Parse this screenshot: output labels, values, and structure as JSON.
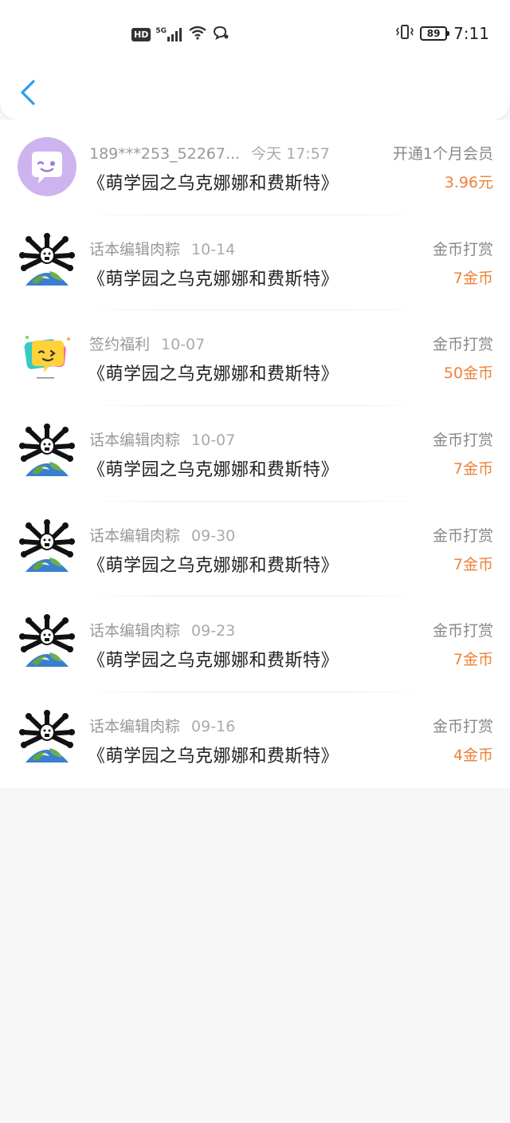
{
  "status_bar": {
    "hd": "HD",
    "network": "5G",
    "battery": "89",
    "time": "7:11"
  },
  "nav": {
    "back_icon": "chevron-left-icon",
    "accent": "#2a9fe8"
  },
  "colors": {
    "amount": "#f0813a",
    "meta": "#999999",
    "title": "#222222"
  },
  "records": [
    {
      "avatar": "chat-bubble-avatar",
      "name": "189***253_52267...",
      "date": "今天 17:57",
      "title": "《萌学园之乌克娜娜和费斯特》",
      "type": "开通1个月会员",
      "amount": "3.96元"
    },
    {
      "avatar": "earth-avatar",
      "name": "话本编辑肉粽",
      "date": "10-14",
      "title": "《萌学园之乌克娜娜和费斯特》",
      "type": "金币打赏",
      "amount": "7金币"
    },
    {
      "avatar": "yellow-bubble-avatar",
      "name": "签约福利",
      "date": "10-07",
      "title": "《萌学园之乌克娜娜和费斯特》",
      "type": "金币打赏",
      "amount": "50金币"
    },
    {
      "avatar": "earth-avatar",
      "name": "话本编辑肉粽",
      "date": "10-07",
      "title": "《萌学园之乌克娜娜和费斯特》",
      "type": "金币打赏",
      "amount": "7金币"
    },
    {
      "avatar": "earth-avatar",
      "name": "话本编辑肉粽",
      "date": "09-30",
      "title": "《萌学园之乌克娜娜和费斯特》",
      "type": "金币打赏",
      "amount": "7金币"
    },
    {
      "avatar": "earth-avatar",
      "name": "话本编辑肉粽",
      "date": "09-23",
      "title": "《萌学园之乌克娜娜和费斯特》",
      "type": "金币打赏",
      "amount": "7金币"
    },
    {
      "avatar": "earth-avatar",
      "name": "话本编辑肉粽",
      "date": "09-16",
      "title": "《萌学园之乌克娜娜和费斯特》",
      "type": "金币打赏",
      "amount": "4金币"
    }
  ]
}
